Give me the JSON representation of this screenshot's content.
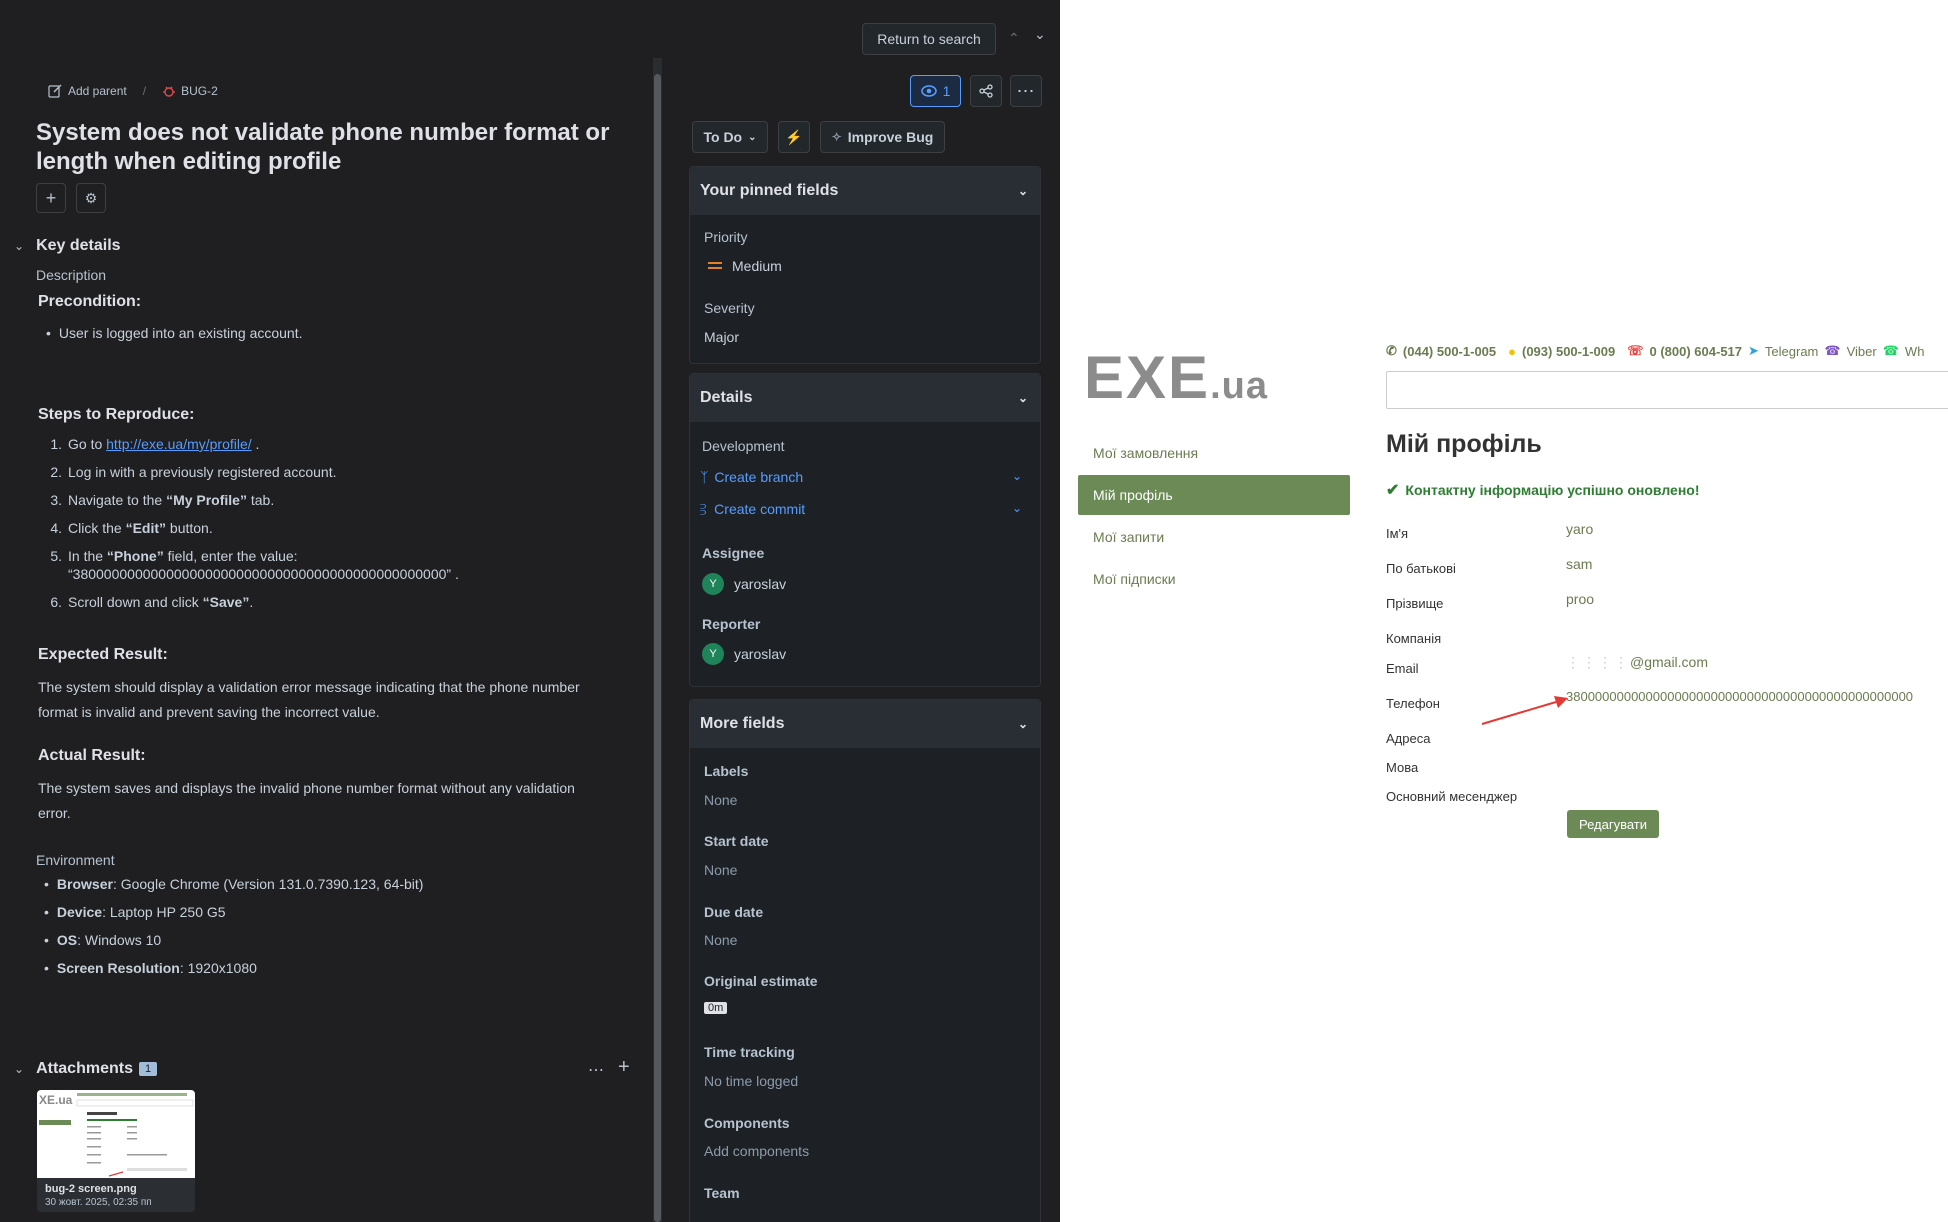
{
  "top": {
    "return_label": "Return to search",
    "watch_count": "1"
  },
  "breadcrumb": {
    "add_parent": "Add parent",
    "separator": "/",
    "issue_key": "BUG-2"
  },
  "issue": {
    "title": "System does not validate phone number format or length when editing profile"
  },
  "key_details": {
    "heading": "Key details",
    "description_label": "Description"
  },
  "description": {
    "precondition_heading": "Precondition:",
    "precondition": "User is logged into an existing account.",
    "steps_heading": "Steps to Reproduce:",
    "steps": [
      {
        "n": "1.",
        "pre": "Go to ",
        "link": "http://exe.ua/my/profile/",
        "post": " ."
      },
      {
        "n": "2.",
        "text": "Log in with a previously registered account."
      },
      {
        "n": "3.",
        "pre": "Navigate to the ",
        "bold": "“My Profile”",
        "post": " tab."
      },
      {
        "n": "4.",
        "pre": "Click the ",
        "bold": "“Edit”",
        "post": " button."
      },
      {
        "n": "5.",
        "pre": "In the ",
        "bold": "“Phone”",
        "post": " field, enter the value:",
        "line2": "“380000000000000000000000000000000000000000000000” ."
      },
      {
        "n": "6.",
        "pre": "Scroll down and click ",
        "bold": "“Save”",
        "post": "."
      }
    ],
    "expected_heading": "Expected Result:",
    "expected_line1": "The system should display a validation error message indicating that the phone number",
    "expected_line2": "format is invalid and prevent saving the incorrect value.",
    "actual_heading": "Actual Result:",
    "actual_line1": "The system saves and displays the invalid phone number format without any validation",
    "actual_line2": "error."
  },
  "environment": {
    "label": "Environment",
    "items": [
      {
        "key": "Browser",
        "value": ": Google Chrome (Version 131.0.7390.123, 64-bit)"
      },
      {
        "key": "Device",
        "value": ": Laptop HP 250 G5"
      },
      {
        "key": "OS",
        "value": ": Windows 10"
      },
      {
        "key": "Screen Resolution",
        "value": ": 1920x1080"
      }
    ]
  },
  "attachments": {
    "heading": "Attachments",
    "count": "1",
    "file_name": "bug-2 screen.png",
    "file_date": "30 жовт. 2025, 02:35 пп"
  },
  "status": {
    "status": "To Do",
    "improve": "Improve Bug"
  },
  "pinned": {
    "title": "Your pinned fields",
    "priority_label": "Priority",
    "priority_value": "Medium",
    "severity_label": "Severity",
    "severity_value": "Major"
  },
  "details": {
    "title": "Details",
    "development_label": "Development",
    "create_branch": "Create branch",
    "create_commit": "Create commit",
    "assignee_label": "Assignee",
    "assignee_name": "yaroslav",
    "reporter_label": "Reporter",
    "reporter_name": "yaroslav",
    "avatar_initial": "Y"
  },
  "more_fields": {
    "title": "More fields",
    "labels_label": "Labels",
    "labels_value": "None",
    "start_label": "Start date",
    "start_value": "None",
    "due_label": "Due date",
    "due_value": "None",
    "estimate_label": "Original estimate",
    "estimate_value": "0m",
    "time_label": "Time tracking",
    "time_value": "No time logged",
    "components_label": "Components",
    "components_value": "Add components",
    "team_label": "Team"
  },
  "site": {
    "logo_main": "EXE",
    "logo_suffix": ".ua",
    "phones": [
      "(044) 500-1-005",
      "(093) 500-1-009",
      "0 (800) 604-517"
    ],
    "messengers": [
      "Telegram",
      "Viber",
      "Wh"
    ],
    "menu": [
      "Мої замовлення",
      "Мій профіль",
      "Мої запити",
      "Мої підписки"
    ],
    "page_title": "Мій профіль",
    "success": "Контактну інформацію успішно оновлено!",
    "fields": [
      {
        "label": "Ім'я",
        "value": "yaro"
      },
      {
        "label": "По батькові",
        "value": "sam"
      },
      {
        "label": "Прізвище",
        "value": "proo"
      },
      {
        "label": "Компанія",
        "value": ""
      },
      {
        "label": "Email",
        "value": "@gmail.com"
      },
      {
        "label": "Телефон",
        "value": "380000000000000000000000000000000000000000000000"
      },
      {
        "label": "Адреса",
        "value": ""
      },
      {
        "label": "Мова",
        "value": ""
      },
      {
        "label": "Основний месенджер",
        "value": ""
      }
    ],
    "edit_button": "Редагувати"
  },
  "colors": {
    "dark_bg": "#1f1f21",
    "panel_bg": "#1d2125",
    "link": "#579dff",
    "site_green": "#6b8a56",
    "success_green": "#2e7d32",
    "arrow_red": "#e53935"
  }
}
